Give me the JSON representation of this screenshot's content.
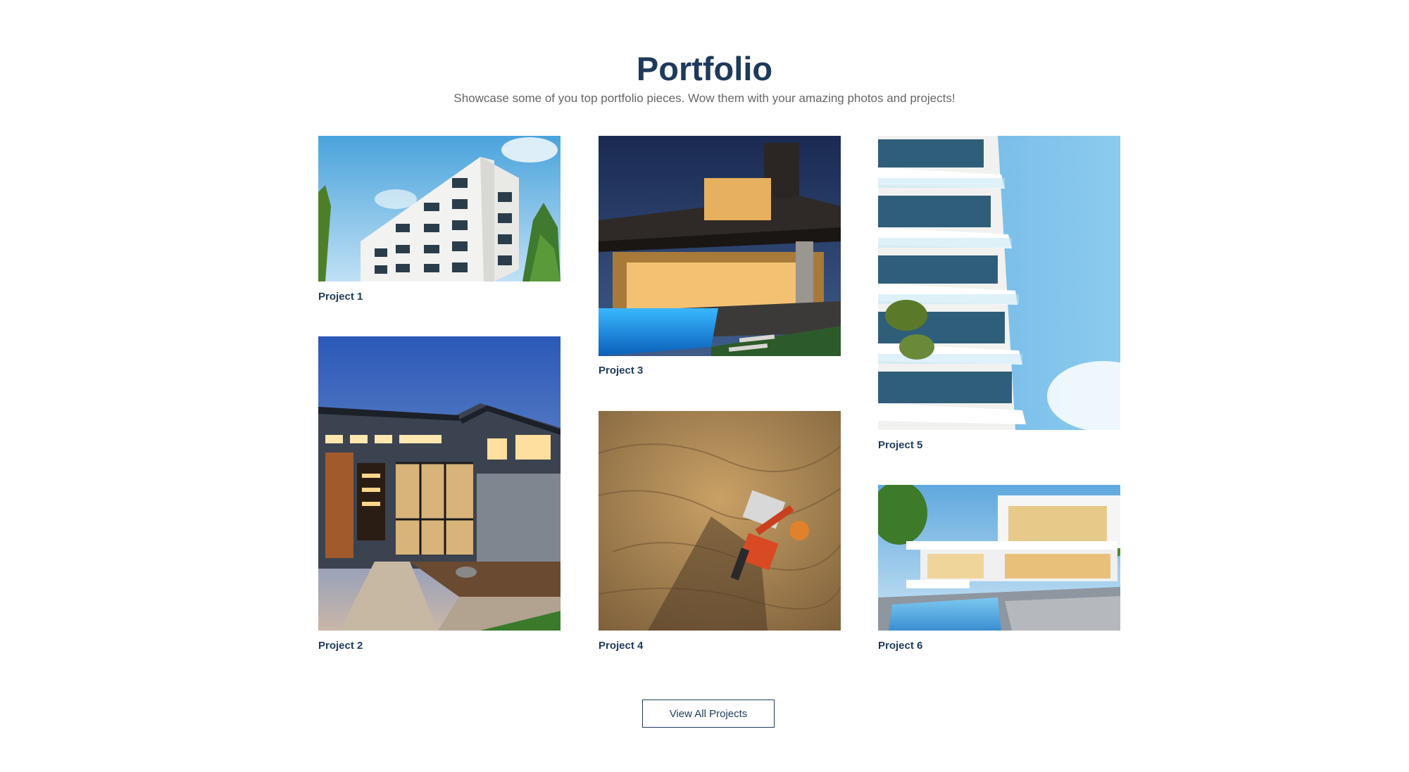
{
  "section": {
    "title": "Portfolio",
    "subtitle": "Showcase some of you top portfolio pieces. Wow them with your amazing photos and projects!"
  },
  "projects": [
    {
      "label": "Project 1",
      "image": "white apartment building against blue sky"
    },
    {
      "label": "Project 2",
      "image": "modern house entrance at dusk"
    },
    {
      "label": "Project 3",
      "image": "modern villa with illuminated pool at night"
    },
    {
      "label": "Project 4",
      "image": "aerial view of excavator on dirt site"
    },
    {
      "label": "Project 5",
      "image": "tall building with glass balconies"
    },
    {
      "label": "Project 6",
      "image": "white modern villa with pool"
    }
  ],
  "cta": {
    "label": "View All Projects"
  }
}
